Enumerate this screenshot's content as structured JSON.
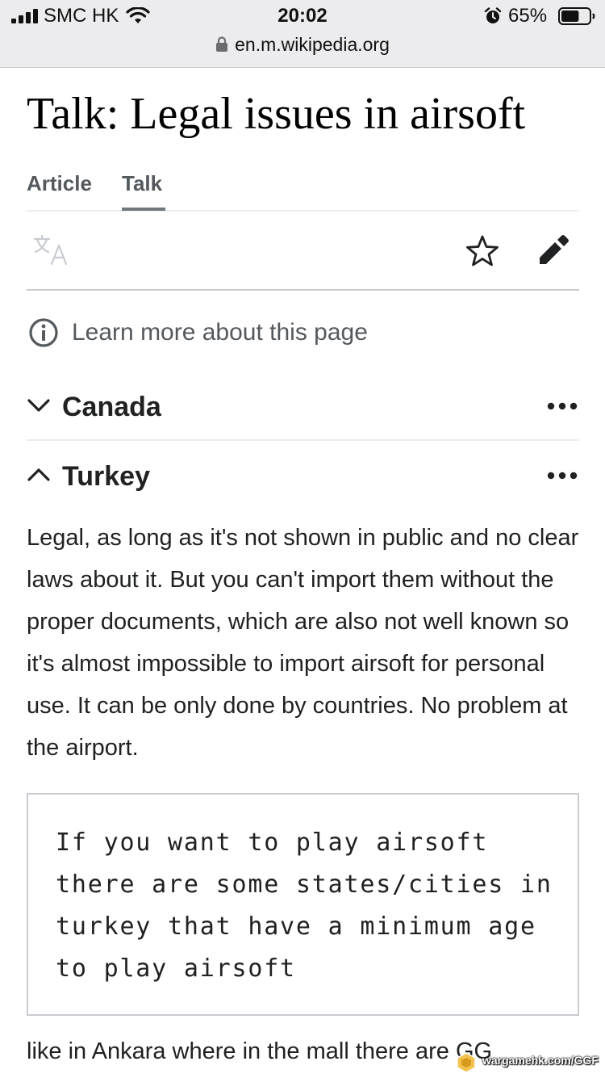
{
  "status_bar": {
    "carrier": "SMC HK",
    "time": "20:02",
    "battery_percent": "65%",
    "battery_level": 0.65,
    "icons": [
      "signal-icon",
      "wifi-icon",
      "alarm-icon",
      "battery-icon"
    ]
  },
  "browser": {
    "url": "en.m.wikipedia.org"
  },
  "page": {
    "title": "Talk: Legal issues in airsoft",
    "tabs": [
      {
        "label": "Article",
        "selected": false
      },
      {
        "label": "Talk",
        "selected": true
      }
    ],
    "toolbar_icons": [
      "language-icon",
      "star-icon",
      "edit-pencil-icon"
    ],
    "learn_more": "Learn more about this page"
  },
  "sections": [
    {
      "heading": "Canada",
      "expanded": false
    },
    {
      "heading": "Turkey",
      "expanded": true,
      "paragraph": "Legal, as long as it's not shown in public and no clear laws about it. But you can't import them without the proper documents, which are also not well known so it's almost impossible to import airsoft for personal use. It can be only done by countries. No problem at the airport.",
      "preformatted": "If you want to play airsoft there are some states/cities in turkey that have a minimum age to play airsoft",
      "paragraph_2": "like in Ankara where in the mall there are GG"
    }
  ],
  "watermark": {
    "text": "wargamehk.com/GGF"
  },
  "colors": {
    "text": "#202122",
    "muted": "#54595d",
    "divider": "#eaecf0",
    "status_bg": "#ececee"
  }
}
